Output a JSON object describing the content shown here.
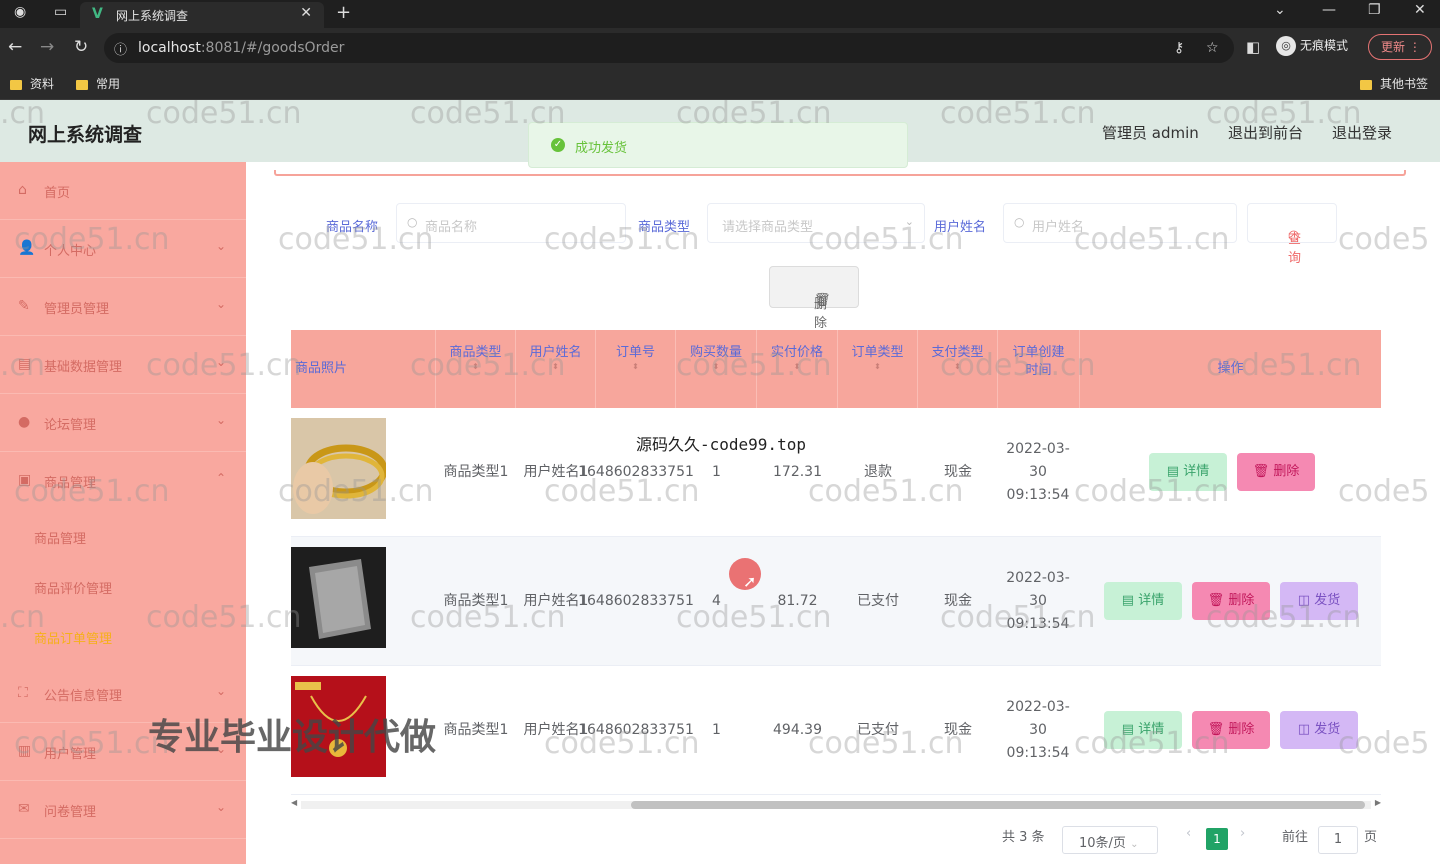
{
  "browser": {
    "tab_title": "网上系统调查",
    "url_host": "localhost",
    "url_rest": ":8081/#/goodsOrder",
    "profile_label": "无痕模式",
    "update_label": "更新",
    "bookmarks": [
      "资料",
      "常用"
    ],
    "bookmarks_other": "其他书签"
  },
  "header": {
    "title": "网上系统调查",
    "links": [
      "管理员 admin",
      "退出到前台",
      "退出登录"
    ]
  },
  "toast": {
    "message": "成功发货"
  },
  "sidebar": {
    "items": [
      {
        "label": "首页",
        "icon": "home-icon"
      },
      {
        "label": "个人中心",
        "icon": "user-icon"
      },
      {
        "label": "管理员管理",
        "icon": "admin-icon"
      },
      {
        "label": "基础数据管理",
        "icon": "database-icon"
      },
      {
        "label": "论坛管理",
        "icon": "forum-icon"
      },
      {
        "label": "商品管理",
        "icon": "goods-icon"
      }
    ],
    "submenu": [
      "商品管理",
      "商品评价管理",
      "商品订单管理"
    ],
    "items_bottom": [
      {
        "label": "公告信息管理",
        "icon": "notice-icon"
      },
      {
        "label": "用户管理",
        "icon": "users-icon"
      },
      {
        "label": "问卷管理",
        "icon": "survey-icon"
      }
    ]
  },
  "search": {
    "name_label": "商品名称",
    "name_placeholder": "商品名称",
    "type_label": "商品类型",
    "type_placeholder": "请选择商品类型",
    "user_label": "用户姓名",
    "user_placeholder": "用户姓名",
    "query_label": "查询",
    "delete_label": "删除"
  },
  "table": {
    "columns": [
      "商品照片",
      "商品类型",
      "用户姓名",
      "订单号",
      "购买数量",
      "实付价格",
      "订单类型",
      "支付类型",
      "订单创建时间",
      "操作"
    ],
    "rows": [
      {
        "goods_type": "商品类型1",
        "user": "用户姓名1",
        "order_no": "1648602833751",
        "qty": "1",
        "price": "172.31",
        "order_type": "退款",
        "pay_type": "现金",
        "created": "2022-03-30 09:13:54",
        "actions": [
          "详情",
          "删除"
        ]
      },
      {
        "goods_type": "商品类型1",
        "user": "用户姓名1",
        "order_no": "1648602833751",
        "qty": "4",
        "price": "81.72",
        "order_type": "已支付",
        "pay_type": "现金",
        "created": "2022-03-30 09:13:54",
        "actions": [
          "详情",
          "删除",
          "发货"
        ]
      },
      {
        "goods_type": "商品类型1",
        "user": "用户姓名1",
        "order_no": "1648602833751",
        "qty": "1",
        "price": "494.39",
        "order_type": "已支付",
        "pay_type": "现金",
        "created": "2022-03-30 09:13:54",
        "actions": [
          "详情",
          "删除",
          "发货"
        ]
      }
    ]
  },
  "pagination": {
    "total": "共 3 条",
    "page_size": "10条/页",
    "current": "1",
    "goto_label": "前往",
    "goto_value": "1",
    "page_suffix": "页"
  },
  "overlays": {
    "watermark": "code51.cn",
    "site_text": "源码久久-code99.top",
    "promo_text": "专业毕业设计代做"
  }
}
